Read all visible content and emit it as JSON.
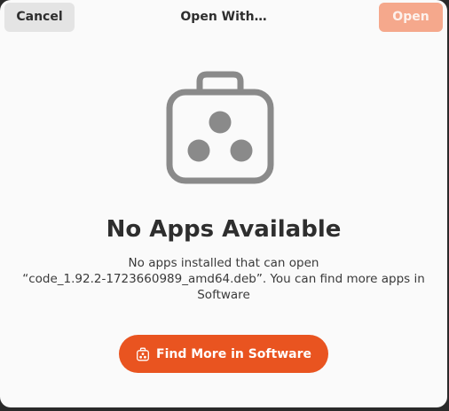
{
  "header": {
    "cancel_label": "Cancel",
    "title": "Open With…",
    "open_label": "Open"
  },
  "status": {
    "icon": "software-bag-icon",
    "heading": "No Apps Available",
    "description_lines": [
      "No apps installed that can open",
      "“code_1.92.2-1723660989_amd64.deb”. You can find more apps in",
      "Software"
    ]
  },
  "action": {
    "icon": "software-bag-icon",
    "label": "Find More in Software"
  },
  "colors": {
    "accent": "#e95420",
    "accent_disabled": "#f5a88c",
    "icon_gray": "#8a8a8a",
    "background": "#fafafa"
  }
}
